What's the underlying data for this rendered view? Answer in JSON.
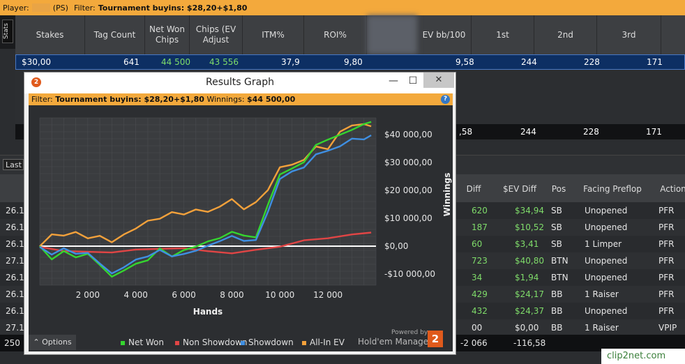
{
  "topbar": {
    "player_label": "Player:",
    "site": "(PS)",
    "filter_label": "Filter:",
    "filter_value": "Tournament buyins: $28,20+$1,80"
  },
  "stats_tab": "Stats",
  "stats_headers": [
    "Stakes",
    "Tag Count",
    "Net Won Chips",
    "Chips (EV Adjust",
    "ITM%",
    "ROI%",
    "EV bb/100",
    "1st",
    "2nd",
    "3rd"
  ],
  "stats_row": {
    "stakes": "$30,00",
    "tag_count": "641",
    "net_won_chips": "44 500",
    "chips_ev": "43 556",
    "itm": "37,9",
    "roi": "9,80",
    "ev_bb": "9,58",
    "first": "244",
    "second": "228",
    "third": "171"
  },
  "stats_row2": {
    "ev_bb": ",58",
    "first": "244",
    "second": "228",
    "third": "171"
  },
  "last_button": "Last",
  "lower_headers": [
    "Diff",
    "$EV Diff",
    "Pos",
    "Facing Preflop",
    "Action"
  ],
  "lower_rows": [
    {
      "date": "26.1",
      "diff": "620",
      "ev": "$34,94",
      "pos": "SB",
      "facing": "Unopened",
      "action": "PFR"
    },
    {
      "date": "26.1",
      "diff": "187",
      "ev": "$10,52",
      "pos": "SB",
      "facing": "Unopened",
      "action": "PFR"
    },
    {
      "date": "26.1",
      "diff": "60",
      "ev": "$3,41",
      "pos": "SB",
      "facing": "1 Limper",
      "action": "PFR"
    },
    {
      "date": "27.1",
      "diff": "723",
      "ev": "$40,80",
      "pos": "BTN",
      "facing": "Unopened",
      "action": "PFR"
    },
    {
      "date": "26.1",
      "diff": "34",
      "ev": "$1,94",
      "pos": "BTN",
      "facing": "Unopened",
      "action": "PFR"
    },
    {
      "date": "26.1",
      "diff": "429",
      "ev": "$24,17",
      "pos": "BB",
      "facing": "1 Raiser",
      "action": "PFR"
    },
    {
      "date": "26.1",
      "diff": "432",
      "ev": "$24,37",
      "pos": "BB",
      "facing": "Unopened",
      "action": "PFR"
    },
    {
      "date": "27.1",
      "diff": "00",
      "ev": "$0,00",
      "pos": "BB",
      "facing": "1 Raiser",
      "action": "VPIP"
    }
  ],
  "total_row": {
    "count": "250",
    "diff": "-2 066",
    "ev": "-116,58"
  },
  "watermark": "clip2net.com",
  "window": {
    "title": "Results Graph",
    "filter_label": "Filter:",
    "filter_value": "Tournament buyins: $28,20+$1,80",
    "winnings_label": "Winnings:",
    "winnings_value": "$44 500,00",
    "options_label": "Options",
    "powered_by": "Powered by",
    "brand": "Hold'em Manager",
    "brand_mark": "2",
    "close_glyph": "✕",
    "minimize_glyph": "—",
    "maximize_glyph": "☐",
    "help_glyph": "?"
  },
  "chart_data": {
    "type": "line",
    "xlabel": "Hands",
    "ylabel": "Winnings",
    "xlim": [
      0,
      14000
    ],
    "ylim": [
      -14000,
      46000
    ],
    "xticks": [
      2000,
      4000,
      6000,
      8000,
      10000,
      12000
    ],
    "xtick_labels": [
      "2 000",
      "4 000",
      "6 000",
      "8 000",
      "10 000",
      "12 000"
    ],
    "yticks": [
      -10000,
      0,
      10000,
      20000,
      30000,
      40000
    ],
    "ytick_labels": [
      "-$10 000,00",
      "$0,00",
      "$10 000,00",
      "$20 000,00",
      "$30 000,00",
      "$40 000,00"
    ],
    "legend_position": "bottom",
    "series": [
      {
        "name": "Net Won",
        "color": "#35d52f",
        "x": [
          0,
          500,
          1000,
          1500,
          2000,
          2500,
          3000,
          3500,
          4000,
          4500,
          5000,
          5500,
          6000,
          6500,
          7000,
          7500,
          8000,
          8500,
          9000,
          9500,
          10000,
          10500,
          11000,
          11500,
          12000,
          12500,
          13000,
          13500,
          13800
        ],
        "y": [
          0,
          -4500,
          -1500,
          -4000,
          -3000,
          -7000,
          -11000,
          -8500,
          -6000,
          -5000,
          -1000,
          -4000,
          -1500,
          0,
          2000,
          3000,
          5000,
          3500,
          3000,
          15000,
          26000,
          28000,
          30000,
          36000,
          38000,
          40000,
          42000,
          44000,
          44500
        ]
      },
      {
        "name": "Non Showdown",
        "color": "#e04545",
        "x": [
          0,
          1000,
          2000,
          3000,
          4000,
          5000,
          6000,
          7000,
          8000,
          9000,
          10000,
          11000,
          12000,
          13000,
          13800
        ],
        "y": [
          0,
          -1500,
          -2000,
          -2500,
          -1500,
          -1000,
          -500,
          -1500,
          -2500,
          -1500,
          -500,
          2000,
          3000,
          4500,
          5000
        ]
      },
      {
        "name": "Showdown",
        "color": "#3f8fe2",
        "x": [
          0,
          500,
          1000,
          1500,
          2000,
          2500,
          3000,
          3500,
          4000,
          4500,
          5000,
          5500,
          6000,
          6500,
          7000,
          7500,
          8000,
          8500,
          9000,
          9500,
          10000,
          10500,
          11000,
          11500,
          12000,
          12500,
          13000,
          13500,
          13800
        ],
        "y": [
          0,
          -3000,
          -1000,
          -3000,
          -2500,
          -6000,
          -9500,
          -7500,
          -5000,
          -4000,
          -1500,
          -3500,
          -2500,
          -1500,
          0,
          1500,
          3500,
          2000,
          2500,
          12500,
          24000,
          26500,
          28000,
          33000,
          34500,
          36000,
          38500,
          38000,
          39500
        ]
      },
      {
        "name": "All-In EV",
        "color": "#f3a13b",
        "x": [
          0,
          500,
          1000,
          1500,
          2000,
          2500,
          3000,
          3500,
          4000,
          4500,
          5000,
          5500,
          6000,
          6500,
          7000,
          7500,
          8000,
          8500,
          9000,
          9500,
          10000,
          10500,
          11000,
          11500,
          12000,
          12500,
          13000,
          13500,
          13800
        ],
        "y": [
          0,
          4000,
          3500,
          5000,
          3000,
          4000,
          1500,
          4000,
          6000,
          9000,
          10000,
          12500,
          11500,
          13000,
          12000,
          14000,
          17000,
          13500,
          16000,
          20000,
          28000,
          29000,
          31000,
          36000,
          35000,
          41000,
          43000,
          43500,
          43000
        ]
      }
    ]
  }
}
